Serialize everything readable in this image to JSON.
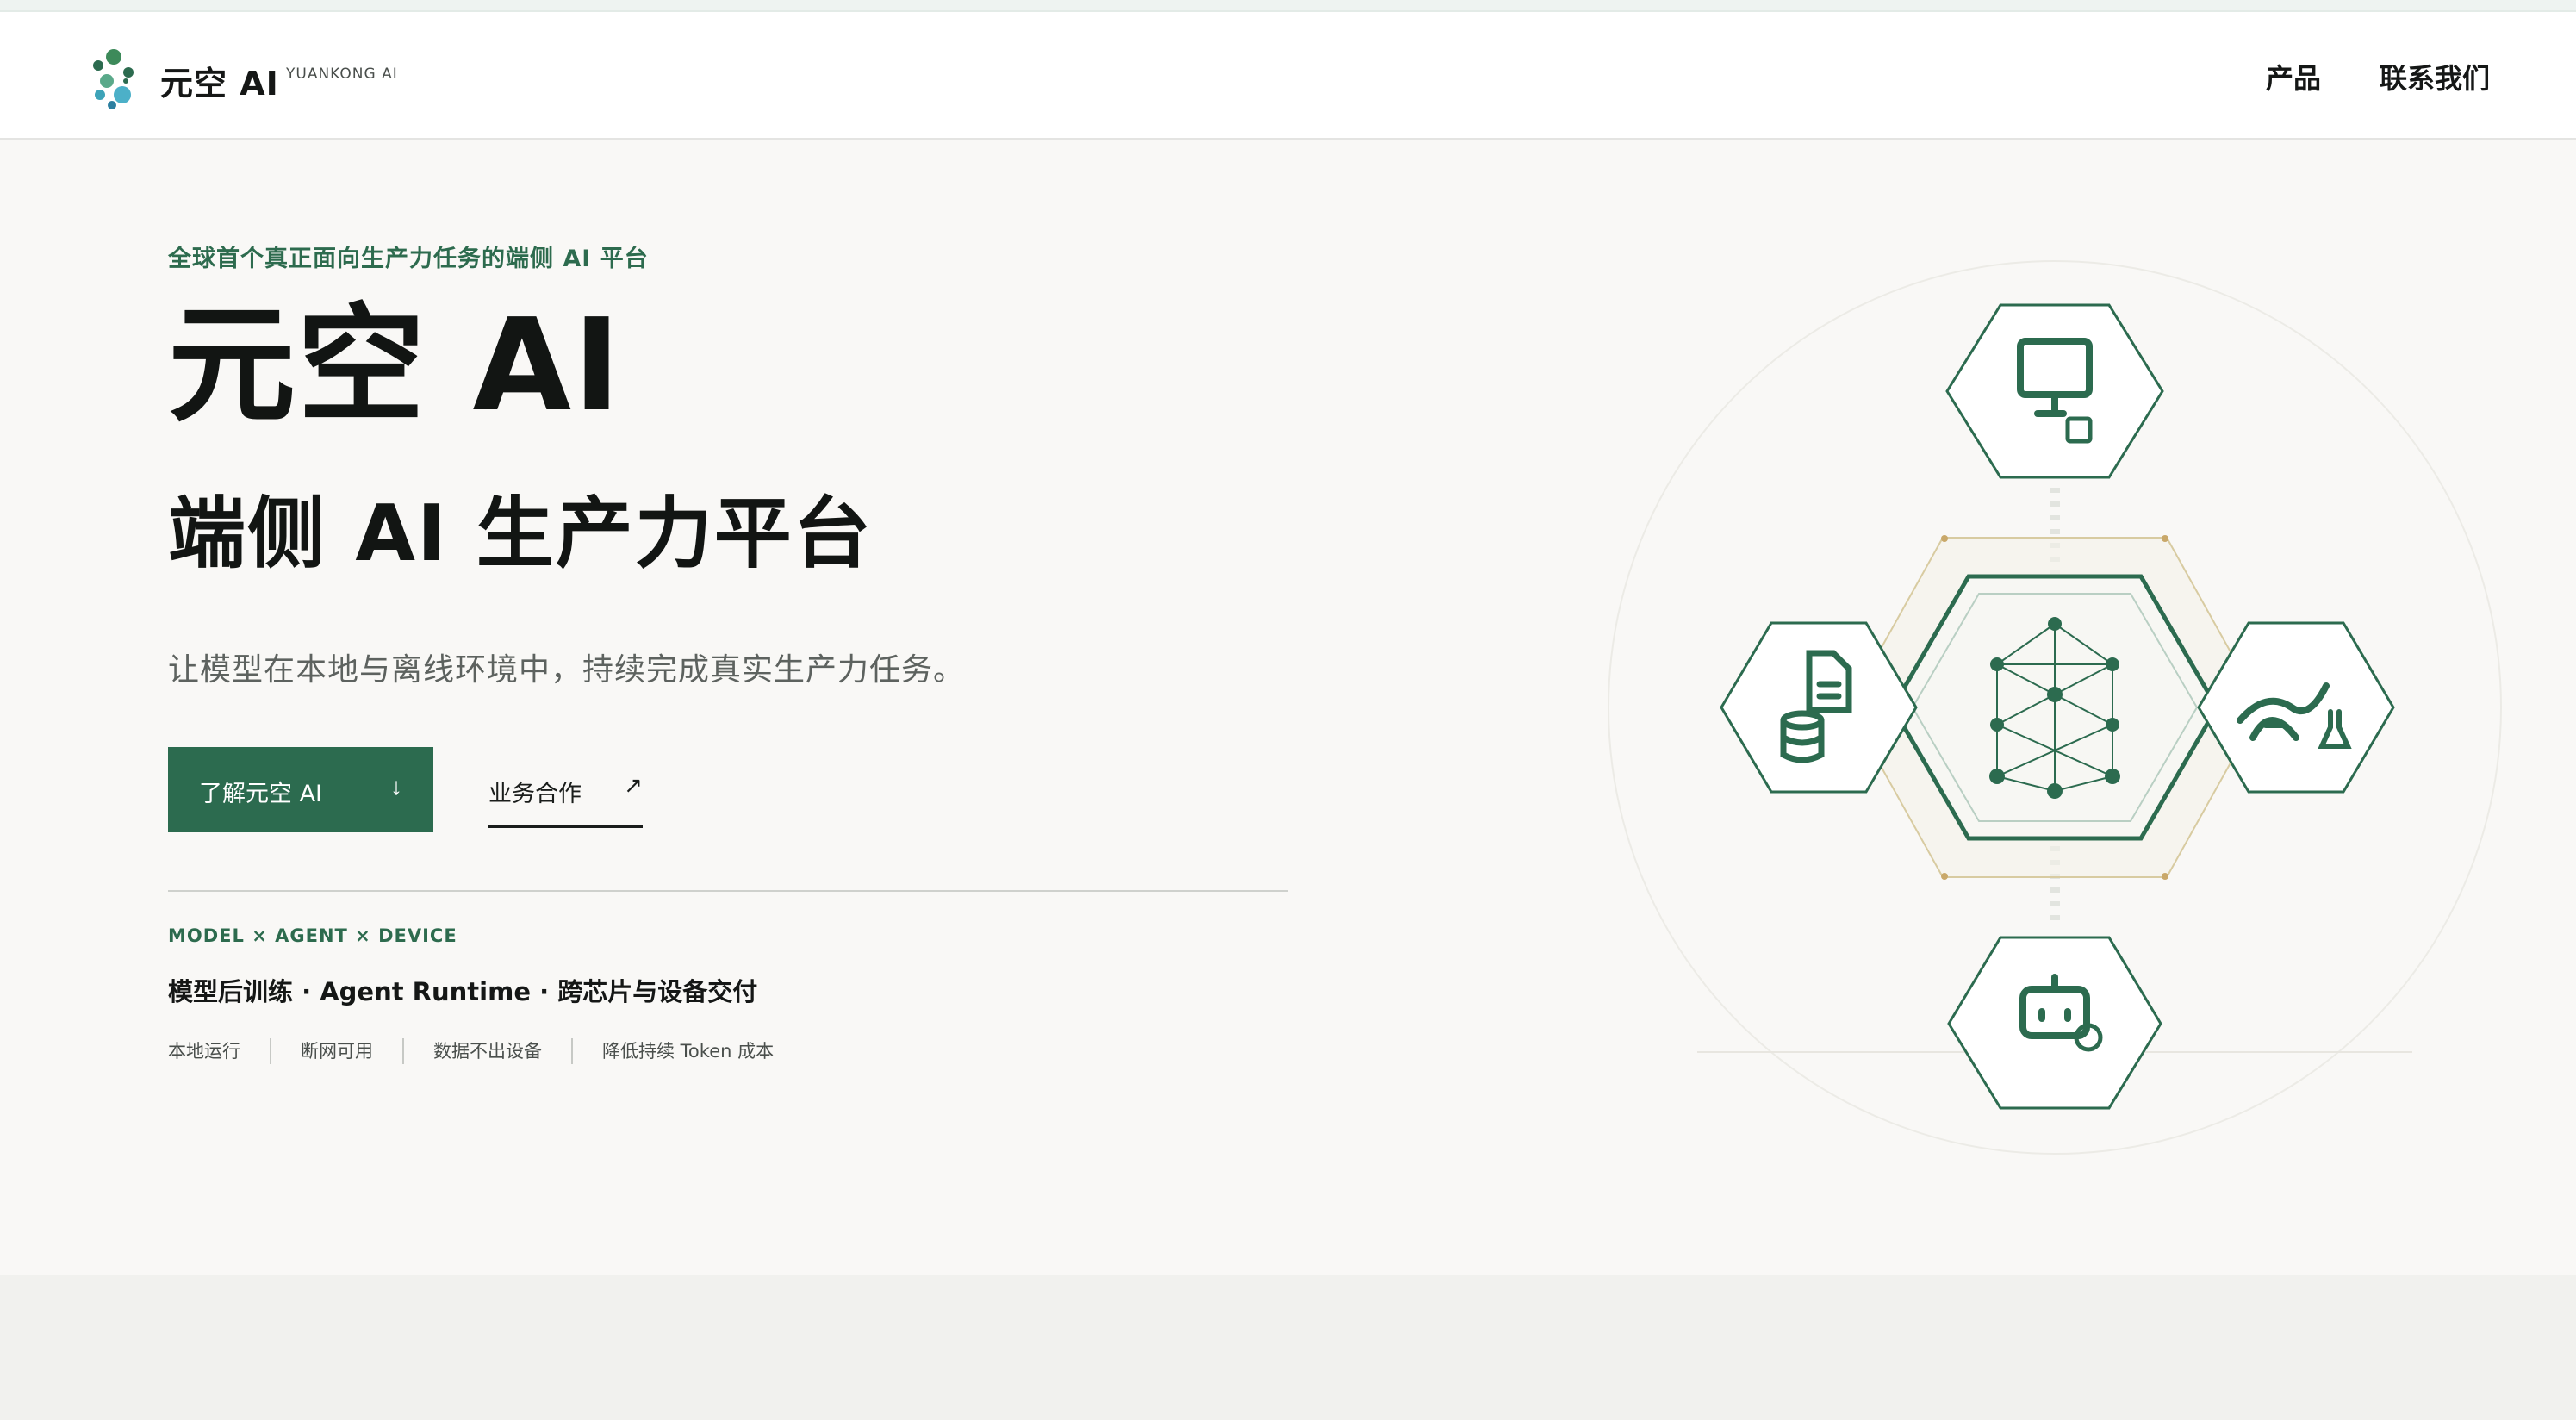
{
  "header": {
    "brand": "元空 AI",
    "brand_sub": "YUANKONG AI",
    "nav": [
      {
        "label": "产品"
      },
      {
        "label": "联系我们"
      }
    ]
  },
  "hero": {
    "eyebrow": "全球首个真正面向生产力任务的端侧 AI 平台",
    "title": "元空 AI",
    "subtitle": "端侧 AI 生产力平台",
    "description": "让模型在本地与离线环境中，持续完成真实生产力任务。",
    "primary_button": {
      "label": "了解元空 AI",
      "icon": "↓"
    },
    "secondary_link": {
      "label": "业务合作",
      "icon": "↗"
    }
  },
  "info": {
    "tag_line": "MODEL × AGENT × DEVICE",
    "tech_line": "模型后训练 · Agent Runtime · 跨芯片与设备交付",
    "features": [
      "本地运行",
      "断网可用",
      "数据不出设备",
      "降低持续 Token 成本"
    ]
  },
  "diagram": {
    "icons": [
      "monitor-chip-icon",
      "document-database-icon",
      "dna-flask-icon",
      "robot-gear-icon",
      "network-graph-icon"
    ]
  },
  "colors": {
    "accent": "#2c6b4f",
    "background": "#f9f8f6",
    "text": "#121513"
  }
}
